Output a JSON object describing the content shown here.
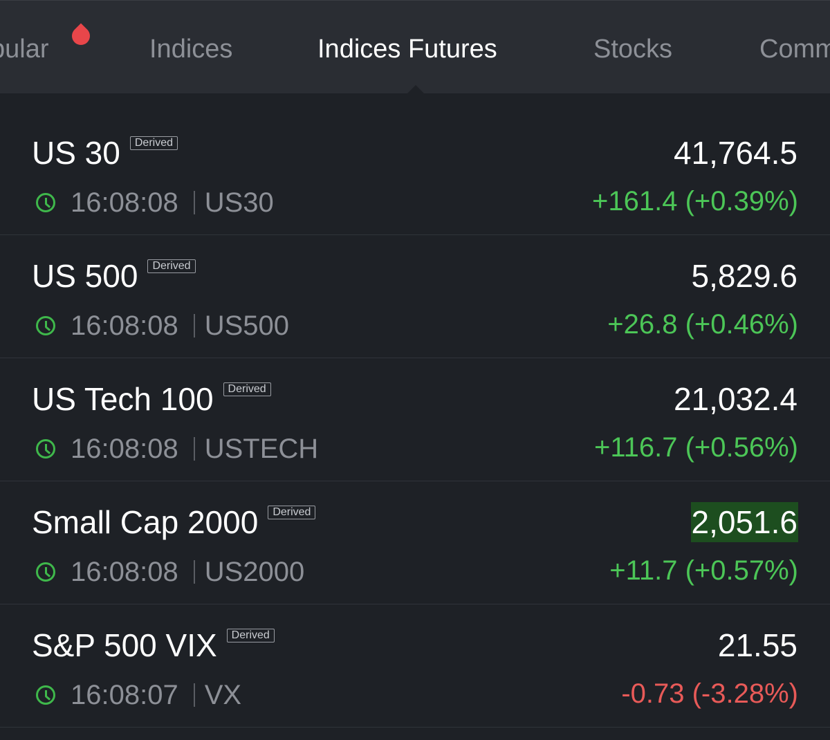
{
  "tabs": [
    {
      "label": "pular",
      "active": false,
      "hot": true
    },
    {
      "label": "Indices",
      "active": false
    },
    {
      "label": "Indices Futures",
      "active": true
    },
    {
      "label": "Stocks",
      "active": false
    },
    {
      "label": "Comm",
      "active": false
    }
  ],
  "colors": {
    "positive": "#4cc657",
    "negative": "#e85a58",
    "flash_bg": "#1d4e1f",
    "hot_dot": "#e8464a"
  },
  "rows": [
    {
      "name": "US 30",
      "badge": "Derived",
      "time": "16:08:08",
      "symbol": "US30",
      "price": "41,764.5",
      "change": "+161.4 (+0.39%)",
      "direction": "up"
    },
    {
      "name": "US 500",
      "badge": "Derived",
      "time": "16:08:08",
      "symbol": "US500",
      "price": "5,829.6",
      "change": "+26.8 (+0.46%)",
      "direction": "up"
    },
    {
      "name": "US Tech 100",
      "badge": "Derived",
      "time": "16:08:08",
      "symbol": "USTECH",
      "price": "21,032.4",
      "change": "+116.7 (+0.56%)",
      "direction": "up"
    },
    {
      "name": "Small Cap 2000",
      "badge": "Derived",
      "time": "16:08:08",
      "symbol": "US2000",
      "price": "2,051.6",
      "change": "+11.7 (+0.57%)",
      "direction": "up",
      "price_flash": true
    },
    {
      "name": "S&P 500 VIX",
      "badge": "Derived",
      "time": "16:08:07",
      "symbol": "VX",
      "price": "21.55",
      "change": "-0.73 (-3.28%)",
      "direction": "down"
    }
  ]
}
